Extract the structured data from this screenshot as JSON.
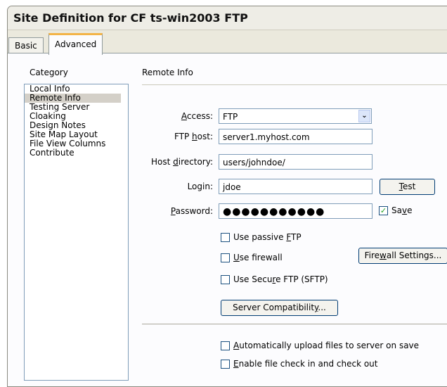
{
  "window": {
    "title": "Site Definition for CF ts-win2003 FTP"
  },
  "tabs": [
    {
      "label": "Basic",
      "active": false
    },
    {
      "label": "Advanced",
      "active": true
    }
  ],
  "category": {
    "heading": "Category",
    "items": [
      "Local Info",
      "Remote Info",
      "Testing Server",
      "Cloaking",
      "Design Notes",
      "Site Map Layout",
      "File View Columns",
      "Contribute"
    ],
    "selected": "Remote Info"
  },
  "remote_info": {
    "title": "Remote Info",
    "access": {
      "label_pre": "",
      "label_key": "A",
      "label_post": "ccess:",
      "value": "FTP"
    },
    "ftp_host": {
      "label_pre": "FTP ",
      "label_key": "h",
      "label_post": "ost:",
      "value": "server1.myhost.com"
    },
    "host_directory": {
      "label_pre": "Host ",
      "label_key": "d",
      "label_post": "irectory:",
      "value": "users/johndoe/"
    },
    "login": {
      "label": "Login:",
      "value": "jdoe"
    },
    "password": {
      "label_pre": "",
      "label_key": "P",
      "label_post": "assword:",
      "value": "●●●●●●●●●●●"
    },
    "test_button": {
      "label_pre": "",
      "label_key": "T",
      "label_post": "est"
    },
    "save": {
      "label_pre": "Sa",
      "label_key": "v",
      "label_post": "e",
      "checked": true
    },
    "passive_ftp": {
      "label_pre": "Use passive ",
      "label_key": "F",
      "label_post": "TP",
      "checked": false
    },
    "firewall": {
      "label_pre": "",
      "label_key": "U",
      "label_post": "se firewall",
      "checked": false
    },
    "firewall_settings_button": {
      "label_pre": "Fire",
      "label_key": "w",
      "label_post": "all Settings..."
    },
    "sftp": {
      "label_pre": "Use Secu",
      "label_key": "r",
      "label_post": "e FTP (SFTP)",
      "checked": false
    },
    "server_compat_button": {
      "label_pre": "Server Compatibilit",
      "label_key": "y",
      "label_post": "..."
    },
    "auto_upload": {
      "label_pre": "",
      "label_key": "A",
      "label_post": "utomatically upload files to server on save",
      "checked": false
    },
    "check_in_out": {
      "label_pre": "",
      "label_key": "E",
      "label_post": "nable file check in and check out",
      "checked": false
    }
  },
  "colors": {
    "dialog_bg": "#ebe9dd",
    "tab_accent": "#f3b448",
    "field_border": "#7f9db9",
    "check_green": "#21a121"
  }
}
